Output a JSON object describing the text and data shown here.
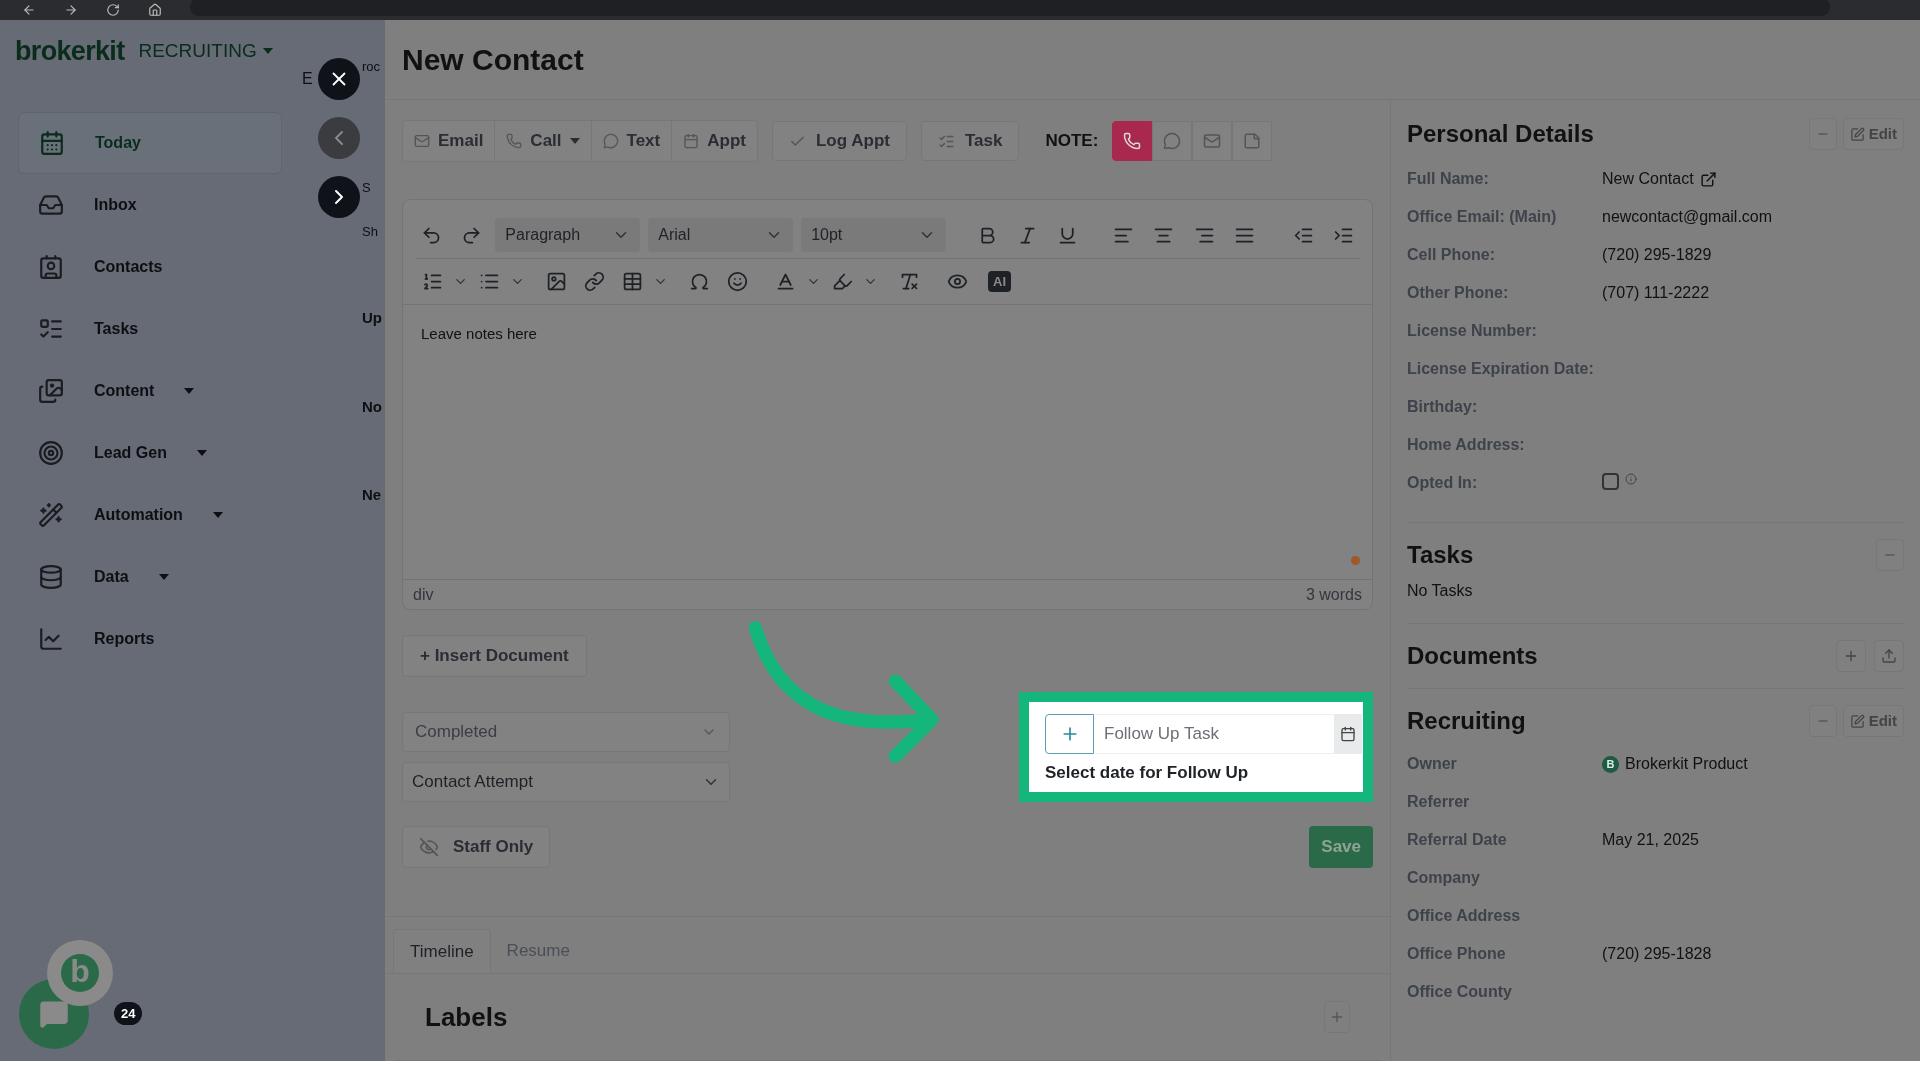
{
  "sidebar": {
    "brand": "brokerkit",
    "workspace": "RECRUITING",
    "items": [
      {
        "label": "Today",
        "selected": true,
        "has_dropdown": false
      },
      {
        "label": "Inbox",
        "selected": false,
        "has_dropdown": false
      },
      {
        "label": "Contacts",
        "selected": false,
        "has_dropdown": false
      },
      {
        "label": "Tasks",
        "selected": false,
        "has_dropdown": false
      },
      {
        "label": "Content",
        "selected": false,
        "has_dropdown": true
      },
      {
        "label": "Lead Gen",
        "selected": false,
        "has_dropdown": true
      },
      {
        "label": "Automation",
        "selected": false,
        "has_dropdown": true
      },
      {
        "label": "Data",
        "selected": false,
        "has_dropdown": true
      },
      {
        "label": "Reports",
        "selected": false,
        "has_dropdown": false
      }
    ]
  },
  "background_page": {
    "top_fragment_1": "E",
    "top_fragment": "roc",
    "fragments": [
      "S",
      "Sh",
      "Up",
      "No",
      "Ne"
    ]
  },
  "chat_widget": {
    "logo": "b",
    "badge": "24"
  },
  "panel": {
    "title": "New Contact",
    "actions": [
      {
        "label": "Email",
        "kind": "mail",
        "has_caret": false
      },
      {
        "label": "Call",
        "kind": "phone",
        "has_caret": true
      },
      {
        "label": "Text",
        "kind": "chat",
        "has_caret": false
      },
      {
        "label": "Appt",
        "kind": "calendar",
        "has_caret": false
      }
    ],
    "log_appt": "Log Appt",
    "task": "Task",
    "note": {
      "label": "NOTE:",
      "options": [
        {
          "kind": "phone",
          "selected": true
        },
        {
          "kind": "chat",
          "selected": false
        },
        {
          "kind": "mail",
          "selected": false
        },
        {
          "kind": "sticky",
          "selected": false
        }
      ]
    },
    "editor": {
      "block_format": "Paragraph",
      "font": "Arial",
      "size": "10pt",
      "ai_button": "AI",
      "content": "Leave notes here",
      "path": "div",
      "word_count": "3 words"
    },
    "insert_document": "+ Insert Document",
    "status_select": "Completed",
    "type_select": "Contact Attempt",
    "staff_only": "Staff Only",
    "follow_up": {
      "placeholder": "Follow Up Task",
      "hint": "Select date for Follow Up"
    },
    "save": "Save",
    "tabs": [
      {
        "label": "Timeline",
        "selected": true
      },
      {
        "label": "Resume",
        "selected": false
      }
    ],
    "labels_title": "Labels"
  },
  "personal_details": {
    "title": "Personal Details",
    "edit": "Edit",
    "fields": [
      {
        "label": "Full Name:",
        "value": "New Contact",
        "kind": "link"
      },
      {
        "label": "Office Email: (Main)",
        "value": "newcontact@gmail.com",
        "kind": "text"
      },
      {
        "label": "Cell Phone:",
        "value": "(720) 295-1829",
        "kind": "text"
      },
      {
        "label": "Other Phone:",
        "value": "(707) 111-2222",
        "kind": "text"
      },
      {
        "label": "License Number:",
        "kind": "text"
      },
      {
        "label": "License Expiration Date:",
        "kind": "text"
      },
      {
        "label": "Birthday:",
        "kind": "text"
      },
      {
        "label": "Home Address:",
        "kind": "text"
      },
      {
        "label": "Opted In:",
        "kind": "checkbox",
        "checked": false
      }
    ]
  },
  "tasks": {
    "title": "Tasks",
    "empty": "No Tasks"
  },
  "documents": {
    "title": "Documents"
  },
  "recruiting": {
    "title": "Recruiting",
    "edit": "Edit",
    "fields": [
      {
        "label": "Owner",
        "value": "Brokerkit Product",
        "kind": "avatar",
        "avatar_letter": "B"
      },
      {
        "label": "Referrer",
        "kind": "text"
      },
      {
        "label": "Referral Date",
        "value": "May 21, 2025",
        "kind": "text"
      },
      {
        "label": "Company",
        "kind": "text"
      },
      {
        "label": "Office Address",
        "kind": "text"
      },
      {
        "label": "Office Phone",
        "value": "(720) 295-1828",
        "kind": "text"
      },
      {
        "label": "Office County",
        "kind": "text"
      }
    ]
  }
}
